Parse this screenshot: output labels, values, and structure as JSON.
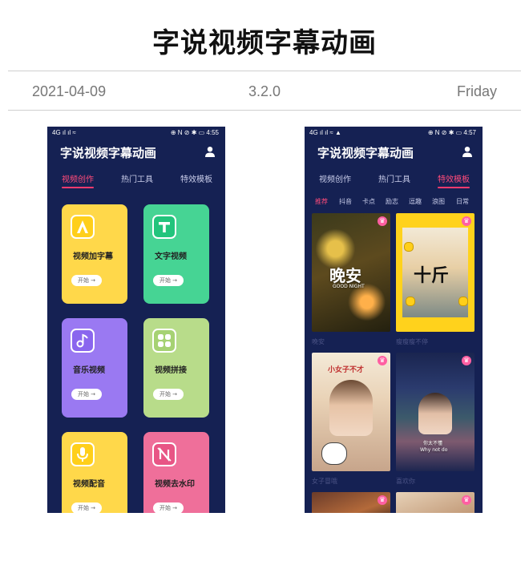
{
  "header": {
    "title": "字说视频字幕动画",
    "date": "2021-04-09",
    "version": "3.2.0",
    "weekday": "Friday"
  },
  "phone1": {
    "status": {
      "left": "4G ıl ıl ≈",
      "right": "⊕ N ⊘ ✱ ▭ 4:55"
    },
    "app_title": "字说视频字幕动画",
    "tabs": [
      "视频创作",
      "热门工具",
      "特效模板"
    ],
    "active_tab": 0,
    "cards": [
      {
        "label": "视频加字幕",
        "button": "开始 →",
        "color": "#ffd84a",
        "icon": "letter-a-icon"
      },
      {
        "label": "文字视频",
        "button": "开始 →",
        "color": "#46d494",
        "icon": "letter-t-icon"
      },
      {
        "label": "音乐视频",
        "button": "开始 →",
        "color": "#9a79f2",
        "icon": "music-note-icon"
      },
      {
        "label": "视频拼接",
        "button": "开始 →",
        "color": "#b8dc8a",
        "icon": "grid-icon"
      },
      {
        "label": "视频配音",
        "button": "开始 →",
        "color": "#ffd84a",
        "icon": "microphone-icon"
      },
      {
        "label": "视频去水印",
        "button": "开始 →",
        "color": "#ef6f9a",
        "icon": "no-watermark-icon"
      }
    ]
  },
  "phone2": {
    "status": {
      "left": "4G ıl ıl ≈ ▲",
      "right": "⊕ N ⊘ ✱ ▭ 4:57"
    },
    "app_title": "字说视频字幕动画",
    "tabs": [
      "视频创作",
      "热门工具",
      "特效模板"
    ],
    "active_tab": 2,
    "categories": [
      "推荐",
      "抖音",
      "卡点",
      "励志",
      "逗趣",
      "浪图",
      "日常"
    ],
    "active_category": 0,
    "tiles": [
      {
        "caption": "晚安",
        "overlay": "晚安",
        "overlay_sub": "GOOD NIGHT"
      },
      {
        "caption": "瘦瘦瘦不停",
        "overlay": "十斤",
        "overlay_sub": ""
      },
      {
        "caption": "女子冒哦",
        "overlay": "小女子不才",
        "overlay_sub": ""
      },
      {
        "caption": "喜欢你",
        "overlay": "你太不懂",
        "overlay_sub": "Why not do"
      }
    ]
  }
}
